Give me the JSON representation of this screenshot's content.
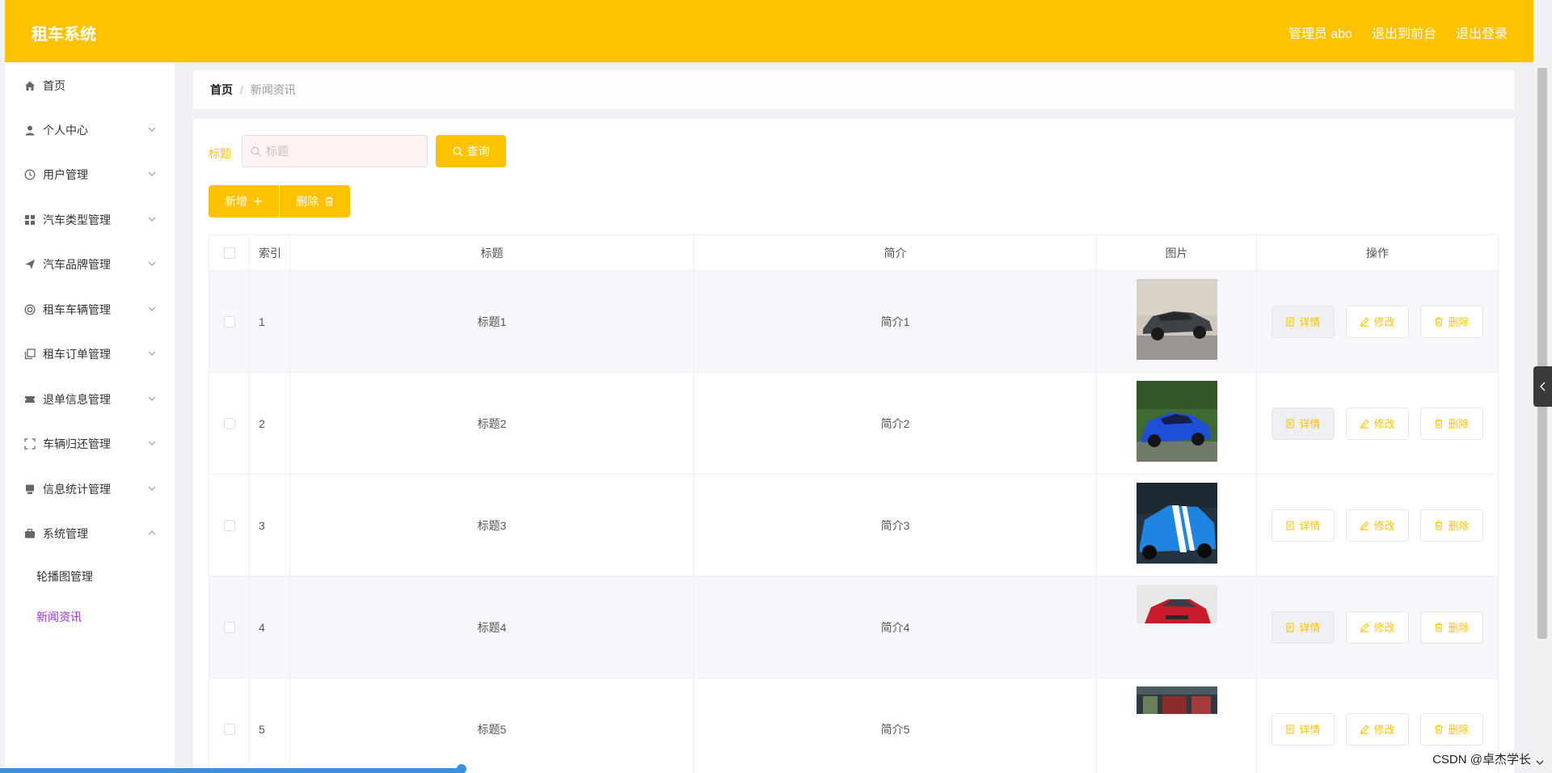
{
  "header": {
    "brand": "租车系统",
    "user": "管理员 abo",
    "to_front": "退出到前台",
    "logout": "退出登录"
  },
  "sidebar": {
    "items": [
      {
        "label": "首页",
        "icon": "home-icon"
      },
      {
        "label": "个人中心",
        "icon": "user-icon"
      },
      {
        "label": "用户管理",
        "icon": "clock-icon"
      },
      {
        "label": "汽车类型管理",
        "icon": "grid-icon"
      },
      {
        "label": "汽车品牌管理",
        "icon": "send-icon"
      },
      {
        "label": "租车车辆管理",
        "icon": "ring-icon"
      },
      {
        "label": "租车订单管理",
        "icon": "copy-icon"
      },
      {
        "label": "退单信息管理",
        "icon": "ticket-icon"
      },
      {
        "label": "车辆归还管理",
        "icon": "fullscreen-icon"
      },
      {
        "label": "信息统计管理",
        "icon": "print-icon"
      },
      {
        "label": "系统管理",
        "icon": "briefcase-icon"
      }
    ],
    "sub": [
      {
        "label": "轮播图管理"
      },
      {
        "label": "新闻资讯"
      }
    ]
  },
  "breadcrumb": {
    "home": "首页",
    "current": "新闻资讯"
  },
  "search": {
    "label": "标题",
    "placeholder": "标题",
    "query_label": "查询"
  },
  "toolbar": {
    "add_label": "新增",
    "delete_label": "删除"
  },
  "table": {
    "headers": {
      "index": "索引",
      "title": "标题",
      "intro": "简介",
      "picture": "图片",
      "actions": "操作"
    },
    "rows": [
      {
        "index": "1",
        "title": "标题1",
        "intro": "简介1"
      },
      {
        "index": "2",
        "title": "标题2",
        "intro": "简介2"
      },
      {
        "index": "3",
        "title": "标题3",
        "intro": "简介3"
      },
      {
        "index": "4",
        "title": "标题4",
        "intro": "简介4"
      },
      {
        "index": "5",
        "title": "标题5",
        "intro": "简介5"
      }
    ],
    "actions": {
      "detail": "详情",
      "edit": "修改",
      "delete": "删除"
    }
  },
  "watermark": "CSDN @卓杰学长",
  "colors": {
    "accent": "#ffc200",
    "active_submenu": "#9b30d9"
  }
}
